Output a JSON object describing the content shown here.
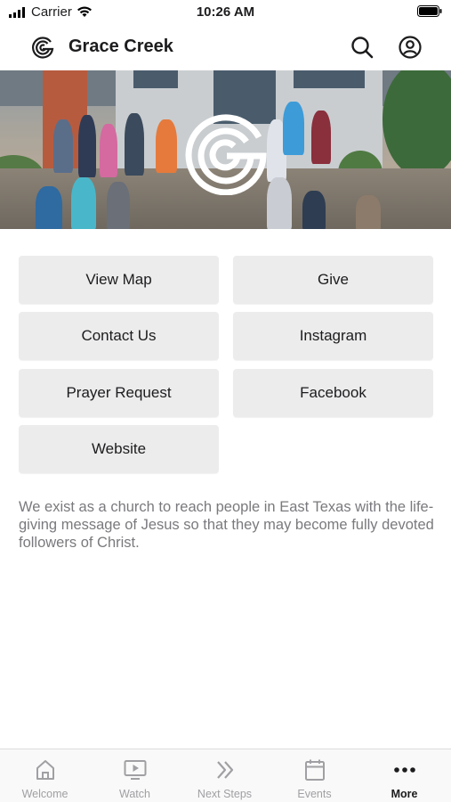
{
  "status_bar": {
    "carrier": "Carrier",
    "time": "10:26 AM"
  },
  "header": {
    "title": "Grace Creek",
    "logo_icon": "grace-creek-logo-icon",
    "search_icon": "search-icon",
    "account_icon": "account-icon"
  },
  "hero": {
    "image": "church-congregation-photo",
    "logo": "grace-creek-logo"
  },
  "buttons": [
    {
      "label": "View Map"
    },
    {
      "label": "Give"
    },
    {
      "label": "Contact Us"
    },
    {
      "label": "Instagram"
    },
    {
      "label": "Prayer Request"
    },
    {
      "label": "Facebook"
    },
    {
      "label": "Website"
    }
  ],
  "description": "We exist as a church to reach people in East Texas with the life-giving message of Jesus so that they may become fully devoted followers of Christ.",
  "tabbar": {
    "items": [
      {
        "label": "Welcome",
        "icon": "home-icon",
        "active": false
      },
      {
        "label": "Watch",
        "icon": "play-icon",
        "active": false
      },
      {
        "label": "Next Steps",
        "icon": "double-chevron-icon",
        "active": false
      },
      {
        "label": "Events",
        "icon": "calendar-icon",
        "active": false
      },
      {
        "label": "More",
        "icon": "more-dots-icon",
        "active": true
      }
    ]
  },
  "colors": {
    "button_bg": "#ececed",
    "text_primary": "#1c1c1e",
    "text_secondary": "#7a7a7e",
    "tab_inactive": "#a0a0a4"
  }
}
